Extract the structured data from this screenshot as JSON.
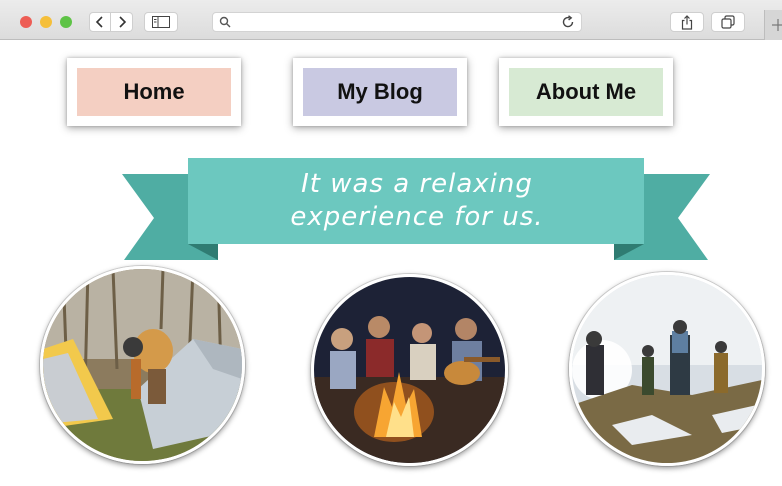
{
  "browser": {
    "traffic_lights": [
      "close",
      "minimize",
      "zoom"
    ],
    "icons": {
      "back": "chevron-left-icon",
      "forward": "chevron-right-icon",
      "sidebar": "sidebar-icon",
      "search": "search-icon",
      "reload": "reload-icon",
      "share": "share-icon",
      "tabs": "tabs-icon",
      "new_tab": "plus-icon"
    },
    "url_text": ""
  },
  "nav": {
    "home": "Home",
    "blog": "My Blog",
    "about": "About Me"
  },
  "banner": {
    "line1": "It was a relaxing",
    "line2": "experience for us."
  },
  "photos": [
    {
      "subject": "person setting up tent in woods"
    },
    {
      "subject": "friends around campfire with guitar"
    },
    {
      "subject": "hikers walking on hill at sunrise"
    }
  ],
  "colors": {
    "home_bg": "#f4cfc2",
    "blog_bg": "#c9c9e2",
    "about_bg": "#d7ead3",
    "ribbon_main": "#6cc8bf",
    "ribbon_tail": "#4fada3",
    "ribbon_fold": "#2f7c72"
  }
}
